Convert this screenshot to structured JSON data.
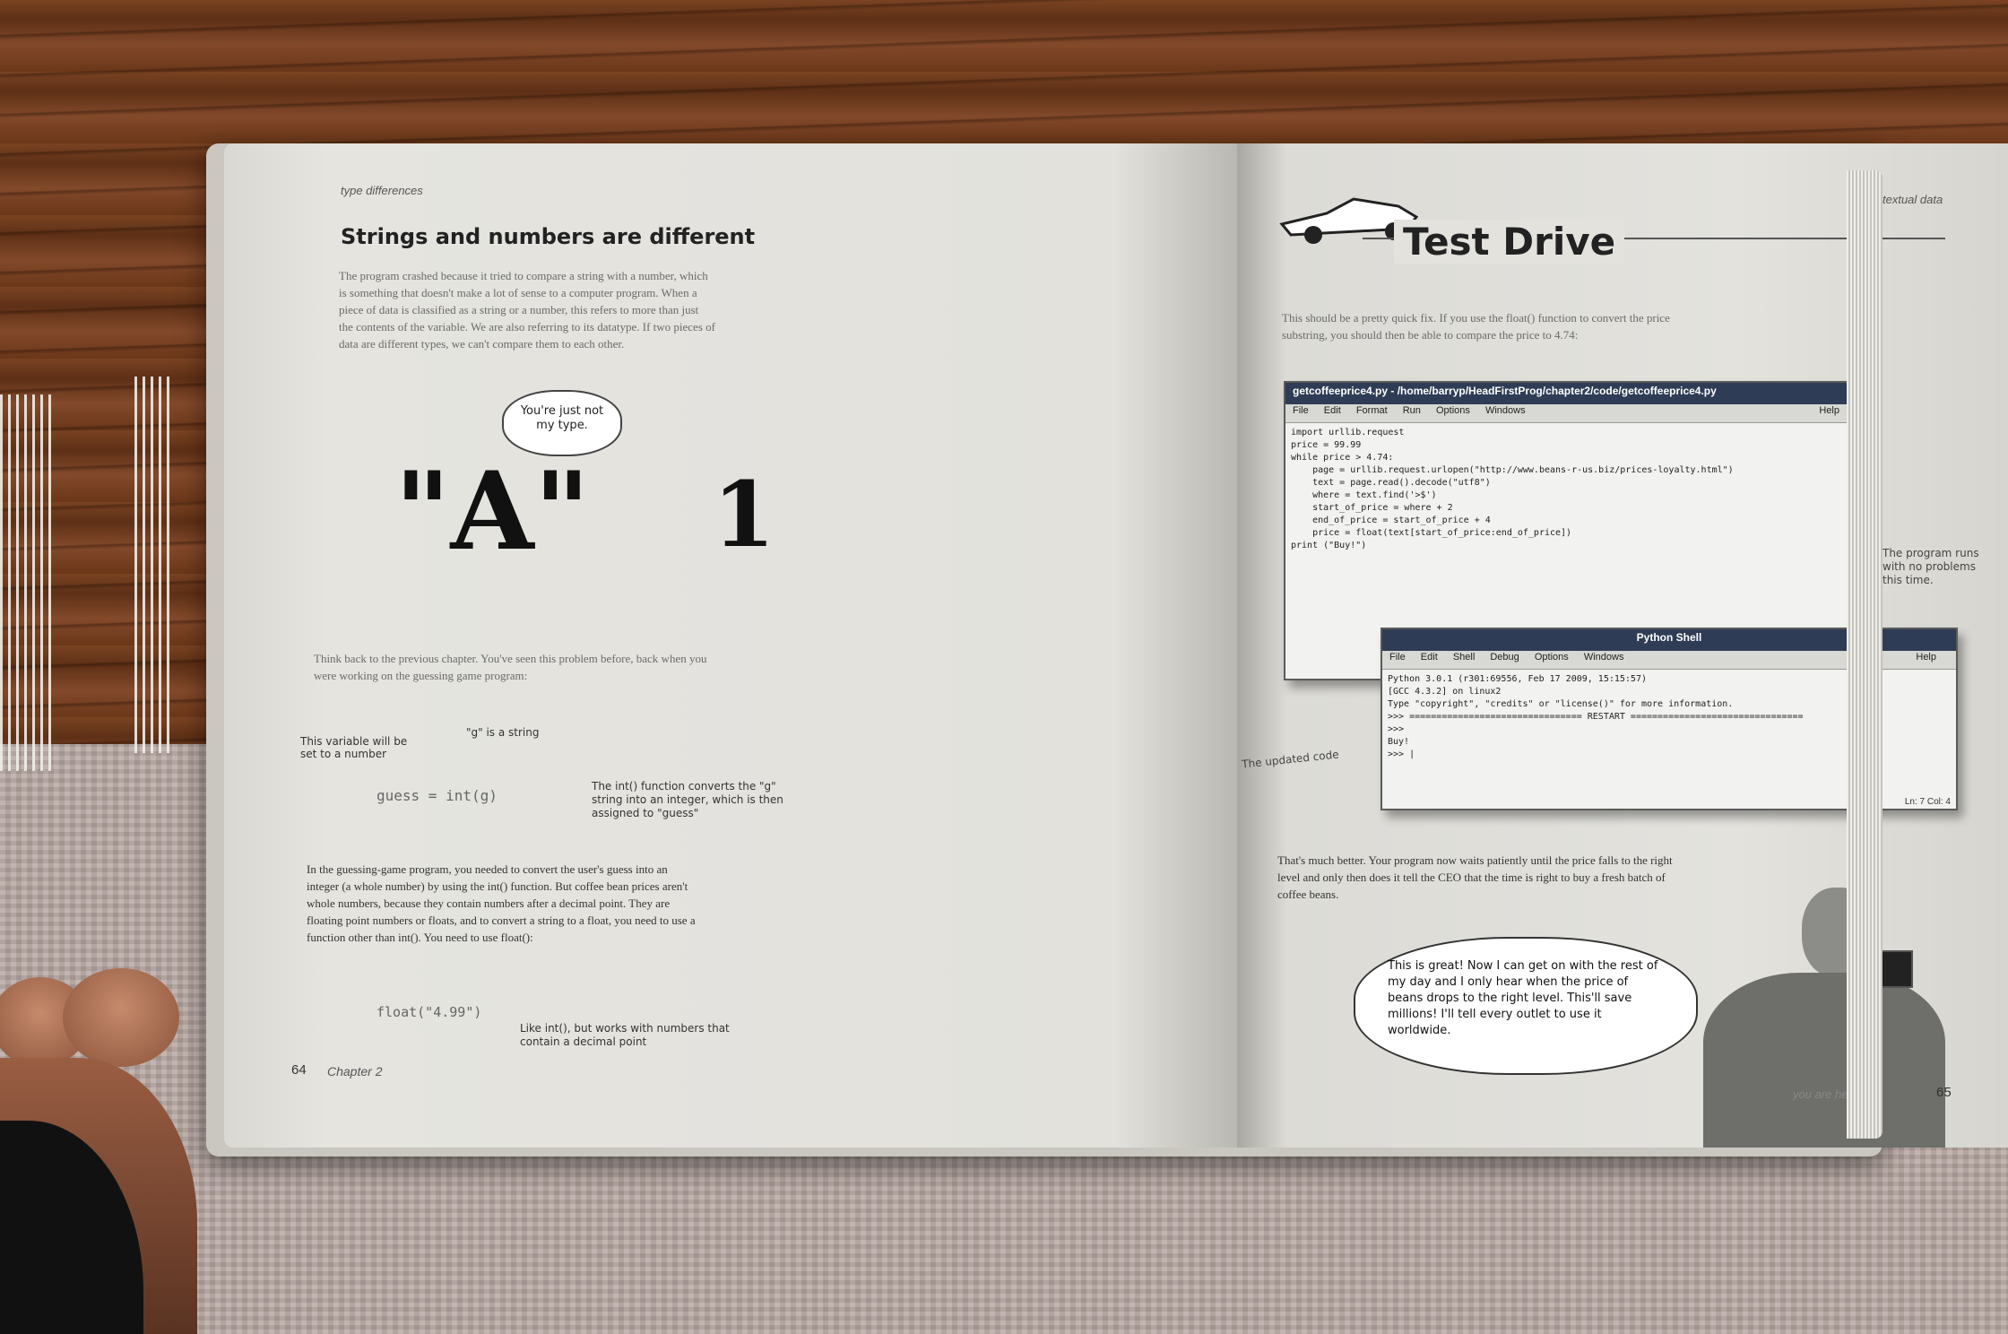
{
  "left_page": {
    "running_head": "type differences",
    "heading": "Strings and numbers are different",
    "intro": "The program crashed because it tried to compare a string with a number, which is something that doesn't make a lot of sense to a computer program. When a piece of data is classified as a string or a number, this refers to more than just the contents of the variable. We are also referring to its datatype. If two pieces of data are different types, we can't compare them to each other.",
    "bubble": "You're just not my type.",
    "big_string": "\"A\"",
    "big_number": "1",
    "para2": "Think back to the previous chapter. You've seen this problem before, back when you were working on the guessing game program:",
    "note_var": "This variable will be set to a number",
    "note_g": "\"g\" is a string",
    "code_guess": "guess = int(g)",
    "note_int": "The int() function converts the \"g\" string into an integer, which is then assigned to \"guess\"",
    "para3": "In the guessing-game program, you needed to convert the user's guess into an integer (a whole number) by using the int() function. But coffee bean prices aren't whole numbers, because they contain numbers after a decimal point. They are floating point numbers or floats, and to convert a string to a float, you need to use a function other than int(). You need to use float():",
    "code_float": "float(\"4.99\")",
    "note_float": "Like int(), but works with numbers that contain a decimal point",
    "page_number": "64",
    "chapter": "Chapter 2"
  },
  "right_page": {
    "running_head": "textual data",
    "heading": "Test Drive",
    "intro": "This should be a pretty quick fix. If you use the float() function to convert the price substring, you should then be able to compare the price to 4.74:",
    "editor": {
      "title": "getcoffeeprice4.py - /home/barryp/HeadFirstProg/chapter2/code/getcoffeeprice4.py",
      "menu": [
        "File",
        "Edit",
        "Format",
        "Run",
        "Options",
        "Windows"
      ],
      "help": "Help",
      "code": [
        "import urllib.request",
        "",
        "price = 99.99",
        "",
        "while price > 4.74:",
        "    page = urllib.request.urlopen(\"http://www.beans-r-us.biz/prices-loyalty.html\")",
        "    text = page.read().decode(\"utf8\")",
        "",
        "    where = text.find('>$')",
        "",
        "    start_of_price = where + 2",
        "    end_of_price = start_of_price + 4",
        "",
        "    price = float(text[start_of_price:end_of_price])",
        "",
        "print (\"Buy!\")"
      ]
    },
    "shell": {
      "title": "Python Shell",
      "menu": [
        "File",
        "Edit",
        "Shell",
        "Debug",
        "Options",
        "Windows"
      ],
      "help": "Help",
      "lines": [
        "Python 3.0.1 (r301:69556, Feb 17 2009, 15:15:57)",
        "[GCC 4.3.2] on linux2",
        "Type \"copyright\", \"credits\" or \"license()\" for more information.",
        ">>> ================================ RESTART ================================",
        ">>>",
        "Buy!",
        ">>> |"
      ],
      "status": "Ln: 7 Col: 4"
    },
    "note_runs": "The program runs with no problems this time.",
    "note_updated": "The updated code",
    "para2": "That's much better. Your program now waits patiently until the price falls to the right level and only then does it tell the CEO that the time is right to buy a fresh batch of coffee beans.",
    "speech": "This is great! Now I can get on with the rest of my day and I only hear when the price of beans drops to the right level. This'll save millions! I'll tell every outlet to use it worldwide.",
    "footer": "you are here ›",
    "page_number": "65"
  }
}
